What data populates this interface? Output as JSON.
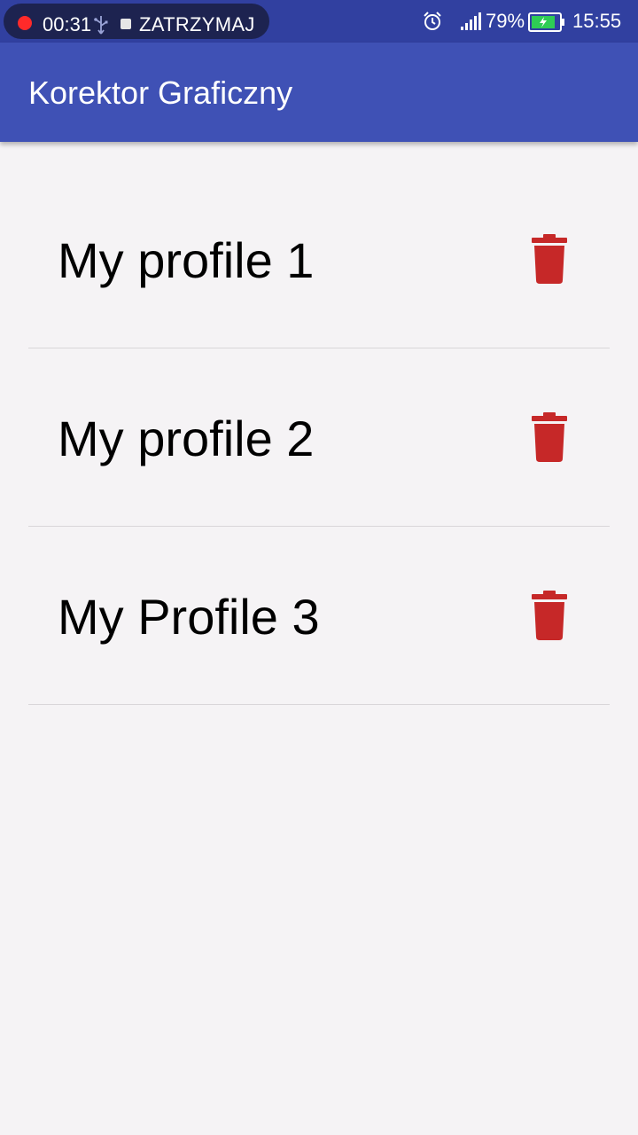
{
  "status_bar": {
    "recording_time": "00:31",
    "stop_label": "ZATRZYMAJ",
    "battery_percent": "79%",
    "clock": "15:55",
    "icons": [
      "record-dot-icon",
      "usb-icon",
      "stop-icon",
      "alarm-icon",
      "signal-icon",
      "battery-icon"
    ]
  },
  "app_bar": {
    "title": "Korektor Graficzny"
  },
  "profiles": [
    {
      "name": "My profile 1",
      "delete_icon": "trash-icon"
    },
    {
      "name": "My profile 2",
      "delete_icon": "trash-icon"
    },
    {
      "name": "My Profile 3",
      "delete_icon": "trash-icon"
    }
  ],
  "colors": {
    "status_bar": "#3140a0",
    "app_bar": "#3f51b5",
    "background": "#f5f3f5",
    "delete_icon": "#c62828",
    "record_dot": "#ff2a2a",
    "battery_fill": "#2ecc55"
  }
}
